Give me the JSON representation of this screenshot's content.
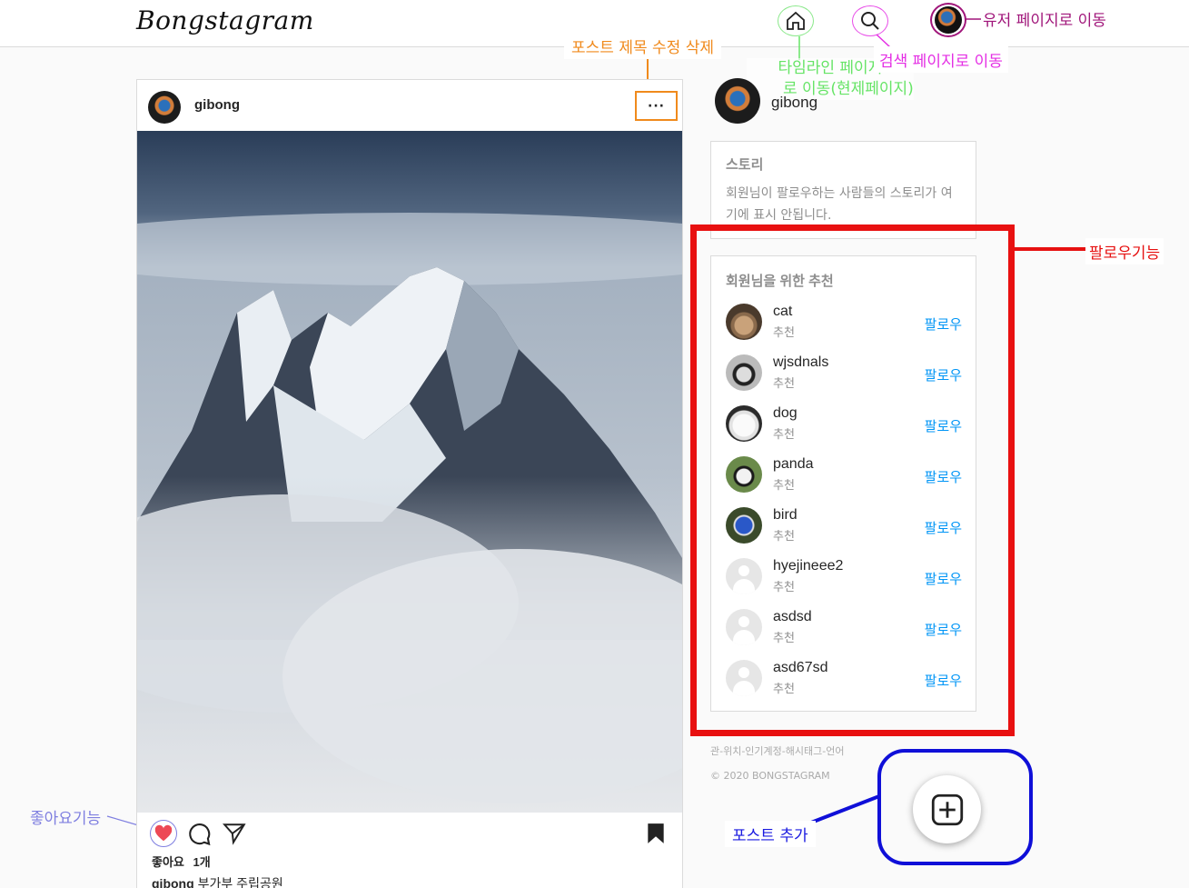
{
  "header": {
    "logo": "Bongstagram",
    "nav": {
      "home_icon": "home-icon",
      "search_icon": "search-icon",
      "user_icon": "profile-avatar"
    }
  },
  "annotations": {
    "post_edit": "포스트 제목 수정 삭제",
    "timeline_line1": "타임라인 페이지",
    "timeline_line2": "로 이동(현제페이지)",
    "search": "검색 페이지로 이동",
    "user": "유저 페이지로 이동",
    "follow": "팔로우기능",
    "like": "좋아요기능",
    "add_post": "포스트 추가"
  },
  "colors": {
    "post_edit": "#f08a1c",
    "timeline": "#66e466",
    "search": "#e42de4",
    "user": "#a0157a",
    "follow": "#e61010",
    "like": "#7f7fe0",
    "add_post": "#1a1ae0",
    "link": "#0095f6"
  },
  "post": {
    "username": "gibong",
    "more_label": "···",
    "likes_label": "좋아요",
    "likes_count": "1개",
    "caption_user": "gibong",
    "caption_text": "부가부 주립공원",
    "icons": [
      "heart-icon",
      "comment-icon",
      "share-icon",
      "bookmark-icon"
    ]
  },
  "sidebar": {
    "profile_name": "gibong",
    "story": {
      "title": "스토리",
      "text": "회원님이 팔로우하는 사람들의 스토리가 여기에 표시 안됩니다."
    },
    "recommend": {
      "title": "회원님을 위한 추천",
      "items": [
        {
          "name": "cat",
          "sub": "추천",
          "action": "팔로우"
        },
        {
          "name": "wjsdnals",
          "sub": "추천",
          "action": "팔로우"
        },
        {
          "name": "dog",
          "sub": "추천",
          "action": "팔로우"
        },
        {
          "name": "panda",
          "sub": "추천",
          "action": "팔로우"
        },
        {
          "name": "bird",
          "sub": "추천",
          "action": "팔로우"
        },
        {
          "name": "hyejineee2",
          "sub": "추천",
          "action": "팔로우"
        },
        {
          "name": "asdsd",
          "sub": "추천",
          "action": "팔로우"
        },
        {
          "name": "asd67sd",
          "sub": "추천",
          "action": "팔로우"
        }
      ]
    },
    "footer_links": "관-위치-인기계정-해시태그-언어",
    "copyright": "© 2020 BONGSTAGRAM"
  },
  "add_post_icon": "plus-square-icon"
}
